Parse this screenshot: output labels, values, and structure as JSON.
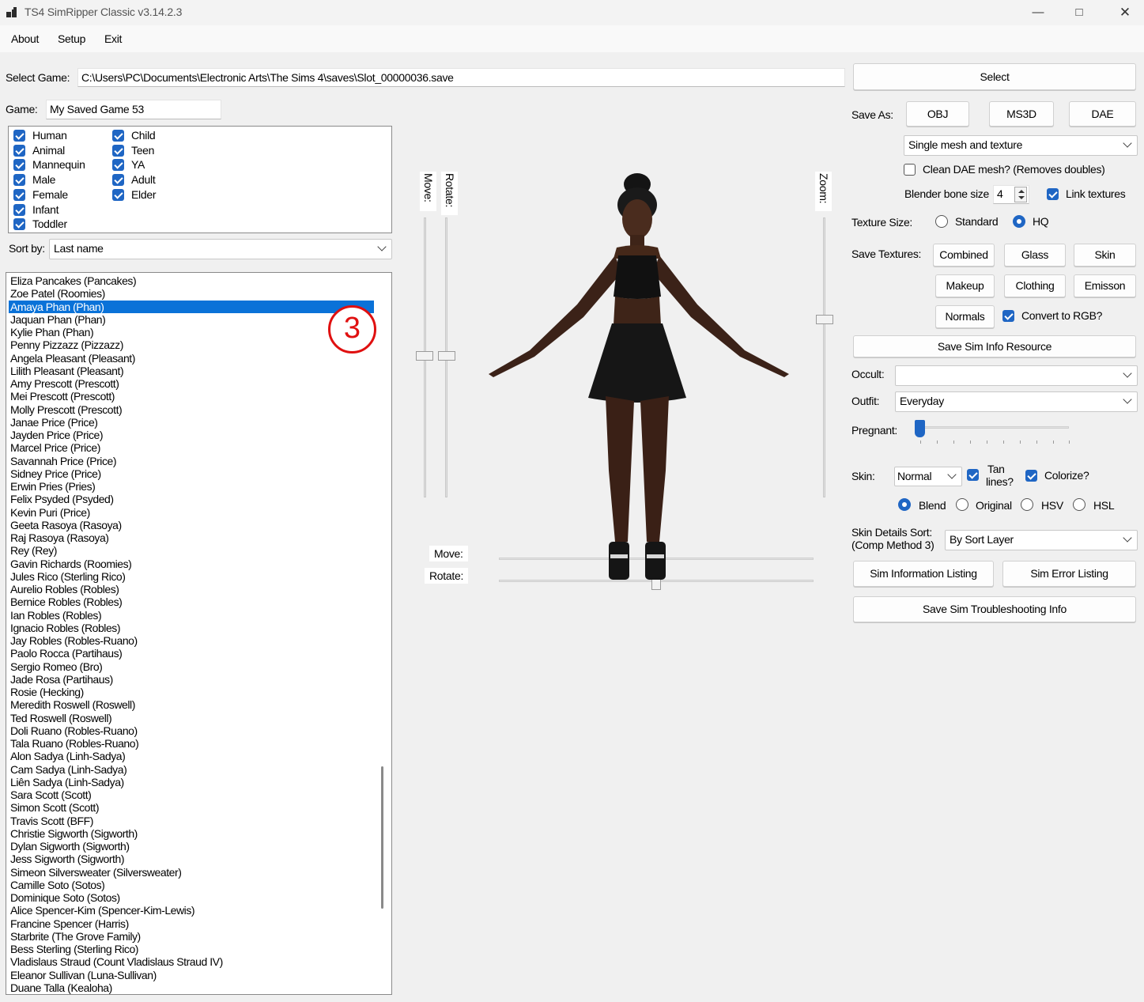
{
  "window": {
    "title": "TS4 SimRipper Classic v3.14.2.3"
  },
  "menu": [
    "About",
    "Setup",
    "Exit"
  ],
  "select_game": {
    "label": "Select Game:",
    "path": "C:\\Users\\PC\\Documents\\Electronic Arts\\The Sims 4\\saves\\Slot_00000036.save",
    "button": "Select"
  },
  "game": {
    "label": "Game:",
    "value": "My Saved Game 53"
  },
  "filters": {
    "col1": [
      {
        "label": "Human",
        "checked": true
      },
      {
        "label": "Animal",
        "checked": true
      },
      {
        "label": "Mannequin",
        "checked": true
      },
      {
        "label": "Male",
        "checked": true
      },
      {
        "label": "Female",
        "checked": true
      },
      {
        "label": "Infant",
        "checked": true
      },
      {
        "label": "Toddler",
        "checked": true
      }
    ],
    "col2": [
      {
        "label": "Child",
        "checked": true
      },
      {
        "label": "Teen",
        "checked": true
      },
      {
        "label": "YA",
        "checked": true
      },
      {
        "label": "Adult",
        "checked": true
      },
      {
        "label": "Elder",
        "checked": true
      }
    ]
  },
  "sort": {
    "label": "Sort by:",
    "value": "Last name"
  },
  "sims": [
    "Eliza Pancakes (Pancakes)",
    "Zoe Patel (Roomies)",
    "Amaya Phan (Phan)",
    "Jaquan Phan (Phan)",
    "Kylie Phan (Phan)",
    "Penny Pizzazz (Pizzazz)",
    "Angela Pleasant (Pleasant)",
    "Lilith Pleasant (Pleasant)",
    "Amy Prescott (Prescott)",
    "Mei Prescott (Prescott)",
    "Molly Prescott (Prescott)",
    "Janae Price (Price)",
    "Jayden Price (Price)",
    "Marcel Price (Price)",
    "Savannah Price (Price)",
    "Sidney Price (Price)",
    "Erwin Pries (Pries)",
    "Felix Psyded (Psyded)",
    "Kevin Puri (Price)",
    "Geeta Rasoya (Rasoya)",
    "Raj Rasoya (Rasoya)",
    "Rey  (Rey)",
    "Gavin Richards (Roomies)",
    "Jules Rico (Sterling Rico)",
    "Aurelio Robles (Robles)",
    "Bernice Robles (Robles)",
    "Ian Robles (Robles)",
    "Ignacio Robles (Robles)",
    "Jay Robles (Robles-Ruano)",
    "Paolo Rocca (Partihaus)",
    "Sergio Romeo (Bro)",
    "Jade Rosa (Partihaus)",
    "Rosie  (Hecking)",
    "Meredith Roswell (Roswell)",
    "Ted Roswell (Roswell)",
    "Doli Ruano (Robles-Ruano)",
    "Tala Ruano (Robles-Ruano)",
    "Alon Sadya (Linh-Sadya)",
    "Cam Sadya (Linh-Sadya)",
    "Liên Sadya (Linh-Sadya)",
    "Sara Scott (Scott)",
    "Simon Scott (Scott)",
    "Travis Scott (BFF)",
    "Christie Sigworth (Sigworth)",
    "Dylan Sigworth (Sigworth)",
    "Jess Sigworth (Sigworth)",
    "Simeon Silversweater (Silversweater)",
    "Camille Soto (Sotos)",
    "Dominique Soto (Sotos)",
    "Alice Spencer-Kim (Spencer-Kim-Lewis)",
    "Francine Spencer (Harris)",
    "Starbrite  (The Grove Family)",
    "Bess Sterling (Sterling Rico)",
    "Vladislaus Straud (Count Vladislaus Straud IV)",
    "Eleanor Sullivan (Luna-Sullivan)",
    "Duane Talla (Kealoha)"
  ],
  "selected_index": 2,
  "annotation": "3",
  "viewport": {
    "move": "Move:",
    "rotate": "Rotate:",
    "zoom": "Zoom:"
  },
  "save_as": {
    "label": "Save As:",
    "buttons": [
      "OBJ",
      "MS3D",
      "DAE"
    ],
    "mode": "Single mesh and texture"
  },
  "clean_dae": {
    "label": "Clean DAE mesh? (Removes doubles)",
    "checked": false
  },
  "blender": {
    "label": "Blender bone size",
    "value": "4"
  },
  "link_textures": {
    "label": "Link textures",
    "checked": true
  },
  "texture_size": {
    "label": "Texture Size:",
    "options": [
      "Standard",
      "HQ"
    ],
    "selected": "HQ"
  },
  "save_textures": {
    "label": "Save Textures:",
    "buttons": [
      "Combined",
      "Glass",
      "Skin",
      "Makeup",
      "Clothing",
      "Emisson",
      "Normals"
    ]
  },
  "convert_rgb": {
    "label": "Convert to RGB?",
    "checked": true
  },
  "save_sim_info": "Save Sim Info Resource",
  "occult": {
    "label": "Occult:",
    "value": ""
  },
  "outfit": {
    "label": "Outfit:",
    "value": "Everyday"
  },
  "pregnant": {
    "label": "Pregnant:",
    "level": 0
  },
  "skin": {
    "label": "Skin:",
    "value": "Normal",
    "tan_line1": "Tan",
    "tan_line2": "lines?",
    "colorize": "Colorize?"
  },
  "blend_modes": {
    "options": [
      "Blend",
      "Original",
      "HSV",
      "HSL"
    ],
    "selected": "Blend"
  },
  "skin_details": {
    "label1": "Skin Details Sort:",
    "label2": "(Comp Method 3)",
    "value": "By Sort Layer"
  },
  "sim_info_listing": "Sim Information Listing",
  "sim_error_listing": "Sim Error Listing",
  "save_troubleshooting": "Save Sim Troubleshooting Info",
  "colors": {
    "accent": "#1f66c4",
    "selection": "#0a72d8",
    "annotation": "#e01010"
  }
}
